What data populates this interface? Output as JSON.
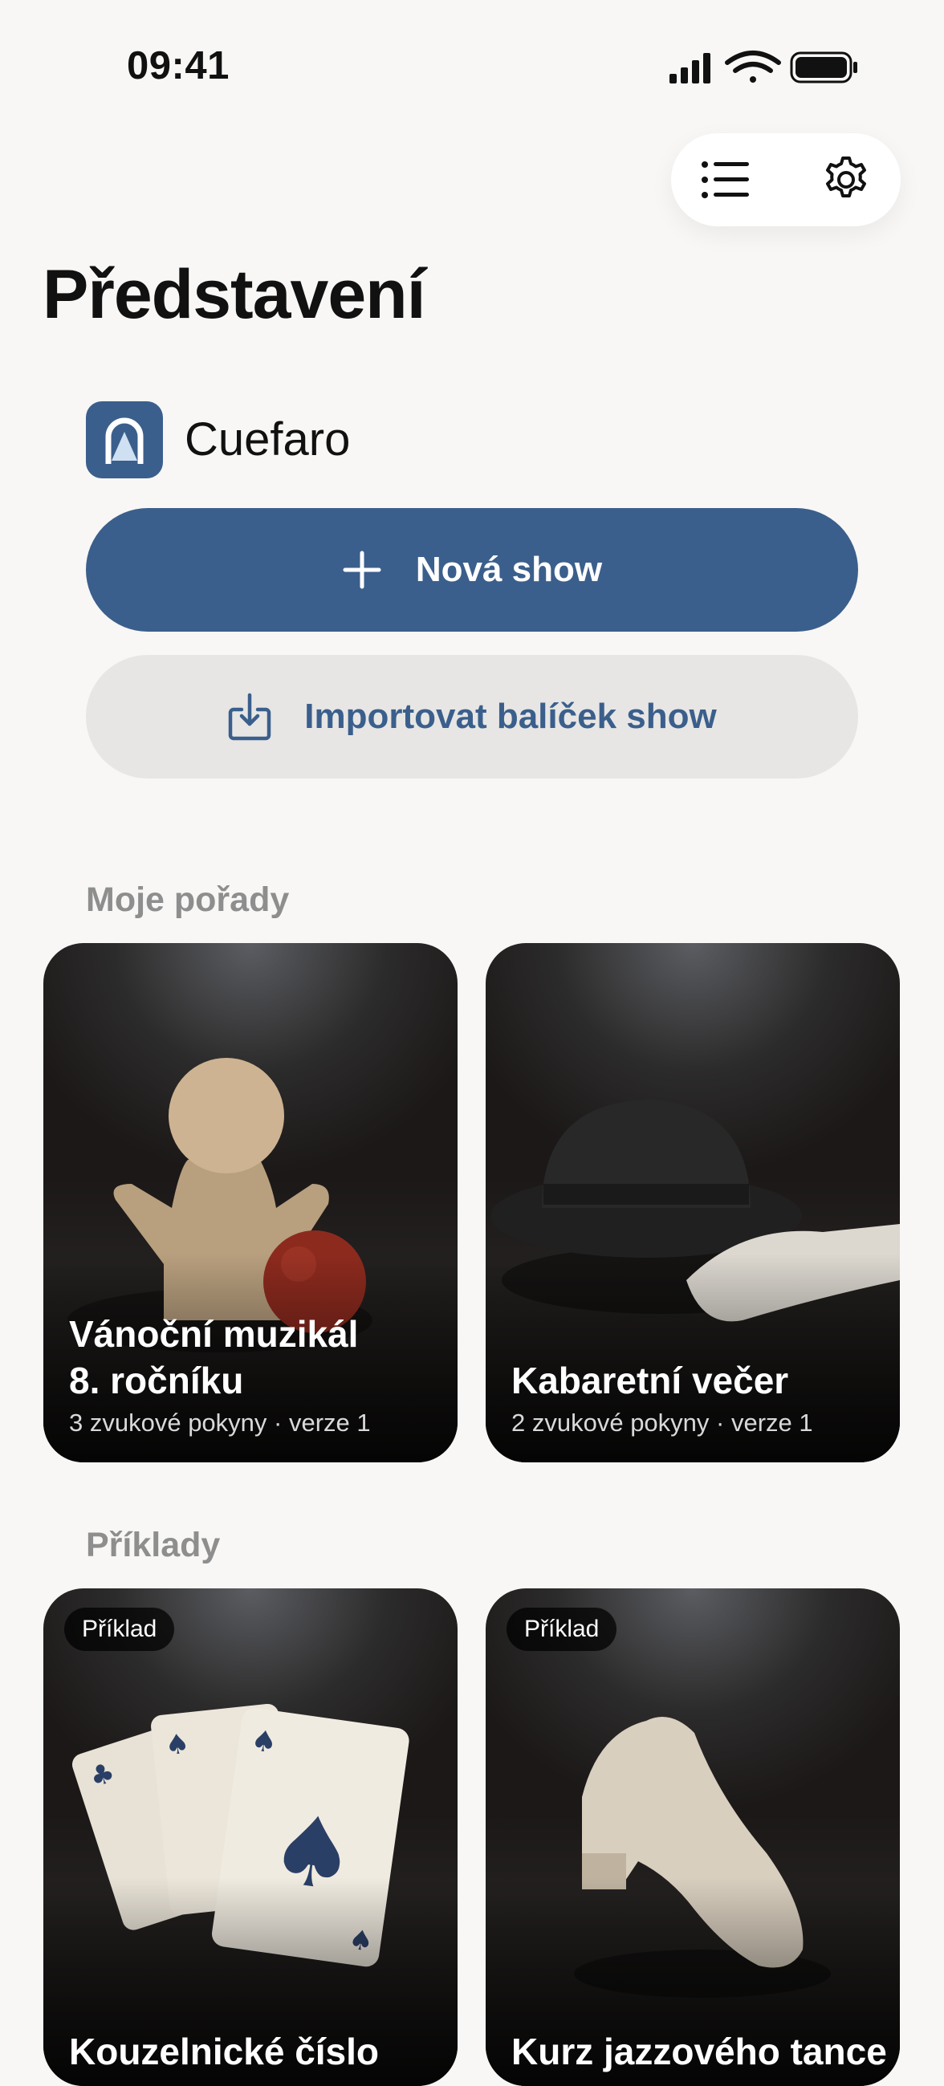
{
  "status_bar": {
    "time": "09:41"
  },
  "toolbar": {
    "list_icon": "list-icon",
    "settings_icon": "gear-icon"
  },
  "page": {
    "title": "Představení"
  },
  "brand": {
    "name": "Cuefaro",
    "logo_color": "#3b5f8c"
  },
  "actions": {
    "new_show": {
      "label": "Nová show",
      "icon": "plus-icon"
    },
    "import_show": {
      "label": "Importovat balíček show",
      "icon": "download-icon"
    }
  },
  "my_shows": {
    "label": "Moje pořady",
    "items": [
      {
        "title_line1": "Vánoční muzikál",
        "title_line2": "8. ročníku",
        "subtitle": "3 zvukové pokyny · verze 1"
      },
      {
        "title_line1": "Kabaretní večer",
        "subtitle": "2 zvukové pokyny · verze 1"
      }
    ]
  },
  "examples": {
    "label": "Příklady",
    "items": [
      {
        "badge": "Příklad",
        "title_line1": "Kouzelnické číslo"
      },
      {
        "badge": "Příklad",
        "title_line1": "Kurz jazzového tance"
      }
    ]
  },
  "colors": {
    "accent": "#3b5f8c",
    "background": "#f8f7f5",
    "secondary_button": "#e7e6e4"
  }
}
